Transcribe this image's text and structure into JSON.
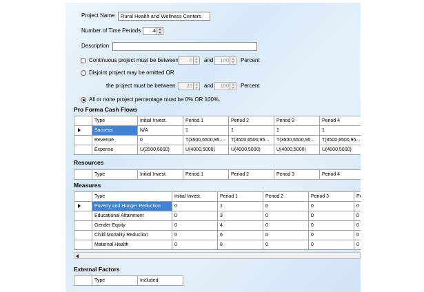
{
  "project": {
    "name_label": "Project Name",
    "name_value": "Rural Health and Wellness Centers",
    "periods_label": "Number of Time Periods",
    "periods_value": "4",
    "description_label": "Description",
    "description_value": ""
  },
  "options": {
    "continuous_label": "Continuous project must be between",
    "continuous_min": "0",
    "continuous_and": "and",
    "continuous_max": "100",
    "continuous_unit": "Percent",
    "disjoint_label": "Disjoint project may be omitted OR",
    "disjoint_sub_label": "the project must be between",
    "disjoint_min": "25",
    "disjoint_and": "and",
    "disjoint_max": "100",
    "disjoint_unit": "Percent",
    "allornone_label": "All or none project percentage must be 0% OR 100%."
  },
  "cashflows": {
    "title": "Pro Forma Cash Flows",
    "headers": [
      "Type",
      "Initial Invest.",
      "Period 1",
      "Period 2",
      "Period 3",
      "Period 4"
    ],
    "rows": [
      [
        "Success",
        "N/A",
        "1",
        "1",
        "1",
        "1"
      ],
      [
        "Revenue",
        "0",
        "T(3500,6500,95...",
        "T(3500,6500,95...",
        "T(3500,6500,95...",
        "T(3500,6500,95..."
      ],
      [
        "Expense",
        "U(2000,6000)",
        "U(4000,5000)",
        "U(4000,5000)",
        "U(4000,5000)",
        "U(4000,5000)"
      ]
    ]
  },
  "resources": {
    "title": "Resources",
    "headers": [
      "Type",
      "Initial Invest.",
      "Period 1",
      "Period 2",
      "Period 3",
      "Period 4"
    ]
  },
  "measures": {
    "title": "Measures",
    "headers": [
      "Type",
      "Initial Invest.",
      "Period 1",
      "Period 2",
      "Period 3",
      "Pe"
    ],
    "rows": [
      [
        "Poverty and Hunger Reduction",
        "0",
        "1",
        "0",
        "0",
        "0"
      ],
      [
        "Educational Attainment",
        "0",
        "3",
        "0",
        "0",
        "0"
      ],
      [
        "Gender Equity",
        "0",
        "4",
        "0",
        "0",
        "0"
      ],
      [
        "Child Mortality Reduction",
        "0",
        "6",
        "0",
        "0",
        "0"
      ],
      [
        "Maternal Health",
        "0",
        "8",
        "0",
        "0",
        "0"
      ]
    ]
  },
  "external": {
    "title": "External Factors",
    "headers": [
      "Type",
      "Included"
    ]
  }
}
